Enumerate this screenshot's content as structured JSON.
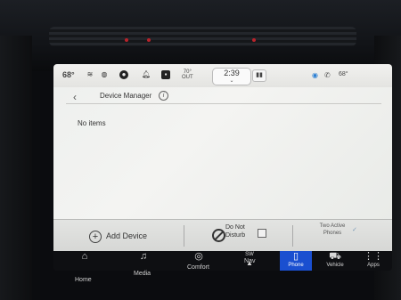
{
  "status_bar": {
    "temperature": "68°",
    "outside_temp_value": "70°",
    "outside_temp_label": "OUT",
    "clock": "2:39",
    "menu_glyph": "▮▮",
    "right_temp": "68°",
    "icons": [
      "seat-heat-icon",
      "steering-heat-icon",
      "profile-icon",
      "bell-icon",
      "app-icon",
      "wifi-icon",
      "phone-icon"
    ]
  },
  "page": {
    "back_glyph": "‹",
    "title": "Device Manager",
    "info_glyph": "i",
    "empty_message": "No items"
  },
  "actions": {
    "add_glyph": "+",
    "add_device": "Add Device",
    "do_not_disturb": "Do Not Disturb",
    "two_active_phones": "Two Active Phones",
    "toggle_glyph": "✓"
  },
  "nav": {
    "items": [
      {
        "label": "Home",
        "icon": "⌂"
      },
      {
        "label": "Media",
        "icon": "♫"
      },
      {
        "label": "Comfort",
        "icon": "◎"
      },
      {
        "label": "Nav",
        "icon": "▲"
      },
      {
        "label": "Phone",
        "icon": "▯"
      },
      {
        "label": "Vehicle",
        "icon": "⛟"
      },
      {
        "label": "Apps",
        "icon": "⋮⋮"
      }
    ],
    "nav_sub": "SW",
    "active": "Phone"
  },
  "colors": {
    "accent": "#1a4fd0",
    "panel": "#f0f1ef"
  }
}
